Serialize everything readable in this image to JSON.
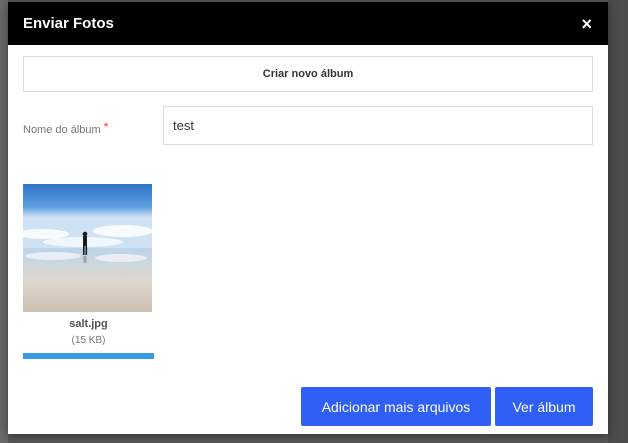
{
  "modal": {
    "title": "Enviar Fotos",
    "close_glyph": "×"
  },
  "new_album": {
    "label": "Criar novo álbum"
  },
  "album_field": {
    "label": "Nome do álbum",
    "required_mark": "*",
    "value": "test"
  },
  "files": [
    {
      "name": "salt.jpg",
      "size": "(15 KB)",
      "upload_progress_percent": 100
    }
  ],
  "actions": {
    "add_more_label": "Adicionar mais arquivos",
    "view_album_label": "Ver álbum"
  },
  "colors": {
    "header_bg": "#000000",
    "primary_button": "#2f5ff5",
    "progress": "#3b9be0",
    "required": "#e03c31"
  }
}
